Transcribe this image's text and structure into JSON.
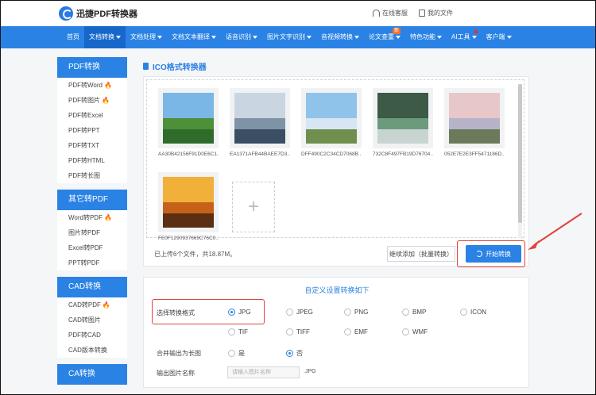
{
  "header": {
    "app_name": "迅捷PDF转换器",
    "links": [
      {
        "icon": "headset-icon",
        "label": "在线客服"
      },
      {
        "icon": "file-icon",
        "label": "我的文件"
      }
    ]
  },
  "nav": {
    "items": [
      {
        "label": "首页",
        "dropdown": false,
        "active": false
      },
      {
        "label": "文档转换",
        "dropdown": true,
        "active": true
      },
      {
        "label": "文档处理",
        "dropdown": true,
        "active": false
      },
      {
        "label": "文档文本翻译",
        "dropdown": true,
        "active": false
      },
      {
        "label": "语音识别",
        "dropdown": true,
        "active": false
      },
      {
        "label": "图片文字识别",
        "dropdown": true,
        "active": false
      },
      {
        "label": "音视频转换",
        "dropdown": true,
        "active": false
      },
      {
        "label": "论文查重",
        "dropdown": true,
        "active": false,
        "badge": "新"
      },
      {
        "label": "特色功能",
        "dropdown": true,
        "active": false
      },
      {
        "label": "AI工具",
        "dropdown": true,
        "active": false
      },
      {
        "label": "客户端",
        "dropdown": true,
        "active": false
      }
    ]
  },
  "sidebar": {
    "groups": [
      {
        "title": "PDF转换",
        "items": [
          {
            "label": "PDF转Word",
            "hot": true
          },
          {
            "label": "PDF转图片",
            "hot": true
          },
          {
            "label": "PDF转Excel",
            "hot": false
          },
          {
            "label": "PDF转PPT",
            "hot": false
          },
          {
            "label": "PDF转TXT",
            "hot": false
          },
          {
            "label": "PDF转HTML",
            "hot": false
          },
          {
            "label": "PDF转长图",
            "hot": false
          }
        ]
      },
      {
        "title": "其它转PDF",
        "items": [
          {
            "label": "Word转PDF",
            "hot": true
          },
          {
            "label": "图片转PDF",
            "hot": false
          },
          {
            "label": "Excel转PDF",
            "hot": false
          },
          {
            "label": "PPT转PDF",
            "hot": false
          }
        ]
      },
      {
        "title": "CAD转换",
        "items": [
          {
            "label": "CAD转PDF",
            "hot": true
          },
          {
            "label": "CAD转图片",
            "hot": false
          },
          {
            "label": "PDF转CAD",
            "hot": false
          },
          {
            "label": "CAD版本转换",
            "hot": false
          }
        ]
      },
      {
        "title": "CA转换",
        "items": []
      }
    ]
  },
  "main": {
    "section_title": "ICO格式转换器",
    "files": [
      {
        "name": "AA30B42156F91D0E6C1..."
      },
      {
        "name": "EA1371AFB44BAEE7D3..."
      },
      {
        "name": "DFF490C2C34CD7068B..."
      },
      {
        "name": "732C8F497FB19D76704..."
      },
      {
        "name": "052E7E2E3FF5471186D..."
      },
      {
        "name": "FE0F1290937669C76C0..."
      }
    ],
    "status": "已上传6个文件，共18.87M。",
    "continue_button": "继续添加（批量转换）",
    "start_button": "开始转换"
  },
  "settings": {
    "title": "自定义设置转换如下",
    "format_label": "选择转换格式",
    "formats_row1": [
      "JPG",
      "JPEG",
      "PNG",
      "BMP",
      "ICON"
    ],
    "formats_row2": [
      "TIF",
      "TIFF",
      "EMF",
      "WMF"
    ],
    "selected_format": "JPG",
    "merge_label": "合并输出为长图",
    "merge_options": [
      "是",
      "否"
    ],
    "merge_selected": "否",
    "name_label": "输出图片名称",
    "name_placeholder": "请输入图片名称",
    "name_ext": ".JPG"
  },
  "colors": {
    "accent": "#2a82e4",
    "highlight": "#e0443a",
    "hot": "#f06a1d"
  }
}
